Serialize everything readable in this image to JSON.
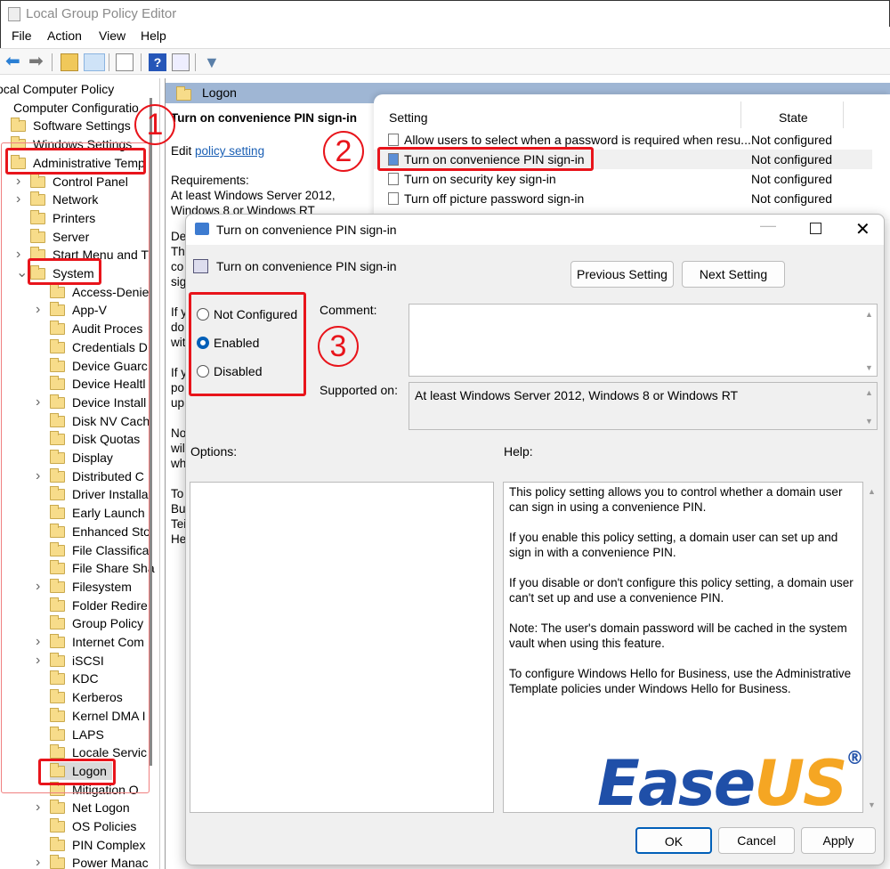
{
  "window": {
    "title": "Local Group Policy Editor"
  },
  "menu": [
    "File",
    "Action",
    "View",
    "Help"
  ],
  "toolbar_icons": [
    "back-arrow-icon",
    "forward-arrow-icon",
    "up-folder-icon",
    "show-hide-tree-icon",
    "export-list-icon",
    "help-icon",
    "properties-icon",
    "filter-icon"
  ],
  "tree": [
    {
      "label": "ocal Computer Policy",
      "level": 0
    },
    {
      "label": "Computer Configuratio",
      "level": 1
    },
    {
      "label": "Software Settings",
      "level": 2
    },
    {
      "label": "Windows Settings",
      "level": 2
    },
    {
      "label": "Administrative Temp",
      "level": 2
    },
    {
      "label": "Control Panel",
      "level": 3,
      "chev": ">"
    },
    {
      "label": "Network",
      "level": 3,
      "chev": ">"
    },
    {
      "label": "Printers",
      "level": 3
    },
    {
      "label": "Server",
      "level": 3
    },
    {
      "label": "Start Menu and T",
      "level": 3,
      "chev": ">"
    },
    {
      "label": "System",
      "level": 3,
      "chev": "v"
    },
    {
      "label": "Access-Denie",
      "level": 4
    },
    {
      "label": "App-V",
      "level": 4,
      "chev": ">"
    },
    {
      "label": "Audit Proces",
      "level": 4
    },
    {
      "label": "Credentials D",
      "level": 4
    },
    {
      "label": "Device Guarc",
      "level": 4
    },
    {
      "label": "Device Healtl",
      "level": 4
    },
    {
      "label": "Device Install",
      "level": 4,
      "chev": ">"
    },
    {
      "label": "Disk NV Cach",
      "level": 4
    },
    {
      "label": "Disk Quotas",
      "level": 4
    },
    {
      "label": "Display",
      "level": 4
    },
    {
      "label": "Distributed C",
      "level": 4,
      "chev": ">"
    },
    {
      "label": "Driver Installa",
      "level": 4
    },
    {
      "label": "Early Launch",
      "level": 4
    },
    {
      "label": "Enhanced Sto",
      "level": 4
    },
    {
      "label": "File Classifica",
      "level": 4
    },
    {
      "label": "File Share Sha",
      "level": 4
    },
    {
      "label": "Filesystem",
      "level": 4,
      "chev": ">"
    },
    {
      "label": "Folder Redire",
      "level": 4
    },
    {
      "label": "Group Policy",
      "level": 4
    },
    {
      "label": "Internet Com",
      "level": 4,
      "chev": ">"
    },
    {
      "label": "iSCSI",
      "level": 4,
      "chev": ">"
    },
    {
      "label": "KDC",
      "level": 4
    },
    {
      "label": "Kerberos",
      "level": 4
    },
    {
      "label": "Kernel DMA I",
      "level": 4
    },
    {
      "label": "LAPS",
      "level": 4
    },
    {
      "label": "Locale Servic",
      "level": 4
    },
    {
      "label": "Logon",
      "level": 4,
      "selected": true
    },
    {
      "label": "Mitigation O",
      "level": 4
    },
    {
      "label": "Net Logon",
      "level": 4,
      "chev": ">"
    },
    {
      "label": "OS Policies",
      "level": 4
    },
    {
      "label": "PIN Complex",
      "level": 4
    },
    {
      "label": "Power Manac",
      "level": 4,
      "chev": ">"
    }
  ],
  "center": {
    "header": "Logon",
    "policy_title": "Turn on convenience PIN sign-in",
    "edit_prefix": "Edit",
    "edit_link": "policy setting",
    "requirements_label": "Requirements:",
    "requirements_1": "At least Windows Server 2012,",
    "requirements_2": "Windows 8 or Windows RT",
    "fragments": [
      "De",
      "Th",
      "co",
      "sig",
      "",
      "If y",
      "do",
      "wit",
      "",
      "If y",
      "po",
      "up",
      "",
      "No",
      "wil",
      "wh",
      "",
      "To",
      "Bu",
      "Tei",
      "He"
    ]
  },
  "list": {
    "col_setting": "Setting",
    "col_state": "State",
    "rows": [
      {
        "setting": "Allow users to select when a password is required when resu...",
        "state": "Not configured"
      },
      {
        "setting": "Turn on convenience PIN sign-in",
        "state": "Not configured",
        "selected": true
      },
      {
        "setting": "Turn on security key sign-in",
        "state": "Not configured"
      },
      {
        "setting": "Turn off picture password sign-in",
        "state": "Not configured"
      }
    ]
  },
  "dialog": {
    "title": "Turn on convenience PIN sign-in",
    "subtitle": "Turn on convenience PIN sign-in",
    "prev": "Previous Setting",
    "next": "Next Setting",
    "radios": [
      "Not Configured",
      "Enabled",
      "Disabled"
    ],
    "selected": "Enabled",
    "comment_label": "Comment:",
    "comment_value": "",
    "supported_label": "Supported on:",
    "supported_value": "At least Windows Server 2012, Windows 8 or Windows RT",
    "options_label": "Options:",
    "help_label": "Help:",
    "help_paragraphs": [
      "This policy setting allows you to control whether a domain user can sign in using a convenience PIN.",
      "If you enable this policy setting, a domain user can set up and sign in with a convenience PIN.",
      "If you disable or don't configure this policy setting, a domain user can't set up and use a convenience PIN.",
      "Note: The user's domain password will be cached in the system vault when using this feature.",
      "To configure Windows Hello for Business, use the Administrative Template policies under Windows Hello for Business."
    ],
    "ok": "OK",
    "cancel": "Cancel",
    "apply": "Apply"
  },
  "annotations": [
    "1",
    "2",
    "3"
  ],
  "watermark": {
    "part1": "Ease",
    "part2": "US",
    "reg": "®",
    "color1": "#1f4fa8",
    "color2": "#f5a623"
  },
  "colors": {
    "annotation": "#e8141b",
    "header_bar": "#9fb6d4",
    "radio_accent": "#005fb8"
  }
}
